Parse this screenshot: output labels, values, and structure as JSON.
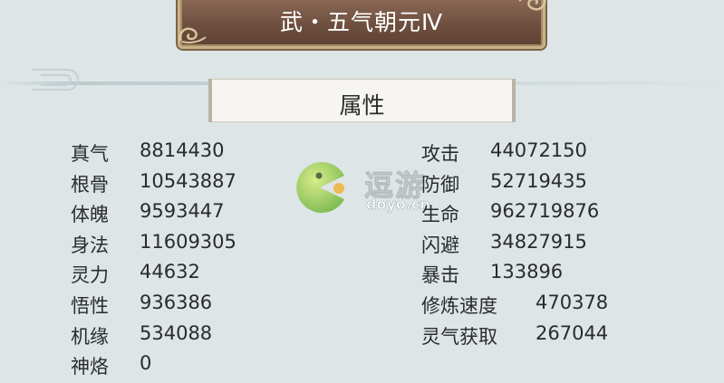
{
  "banner": {
    "title": "武・五气朝元Ⅳ"
  },
  "section": {
    "title": "属性"
  },
  "left_stats": [
    {
      "name": "真气",
      "value": "8814430"
    },
    {
      "name": "根骨",
      "value": "10543887"
    },
    {
      "name": "体魄",
      "value": "9593447"
    },
    {
      "name": "身法",
      "value": "11609305"
    },
    {
      "name": "灵力",
      "value": "44632"
    },
    {
      "name": "悟性",
      "value": "936386"
    },
    {
      "name": "机缘",
      "value": "534088"
    },
    {
      "name": "神烙",
      "value": "0"
    }
  ],
  "right_stats": [
    {
      "name": "攻击",
      "value": "44072150"
    },
    {
      "name": "防御",
      "value": "52719435"
    },
    {
      "name": "生命",
      "value": "962719876"
    },
    {
      "name": "闪避",
      "value": "34827915"
    },
    {
      "name": "暴击",
      "value": "133896"
    },
    {
      "name": "修炼速度",
      "value": "470378"
    },
    {
      "name": "灵气获取",
      "value": "267044"
    }
  ],
  "watermark": {
    "brand": "逗游",
    "site": "doyo.cn",
    "icon": "pacman-logo-icon"
  }
}
